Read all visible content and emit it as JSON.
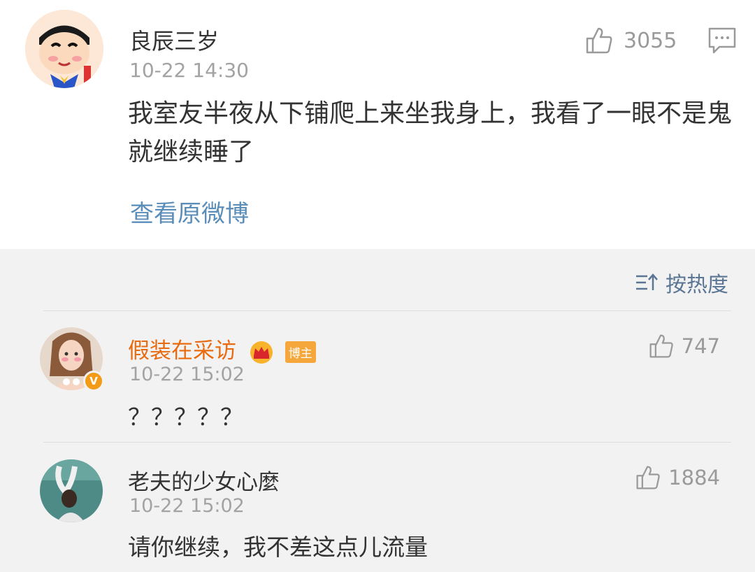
{
  "post": {
    "author": "良辰三岁",
    "time": "10-22 14:30",
    "like_count": "3055",
    "text": "我室友半夜从下铺爬上来坐我身上，我看了一眼不是鬼就继续睡了",
    "view_original": "查看原微博"
  },
  "sort": {
    "label": "按热度",
    "icon": "sort-icon"
  },
  "comments": [
    {
      "author": "假装在采访",
      "badge": "博主",
      "verified": "V",
      "time": "10-22 15:02",
      "like_count": "747",
      "text": "？？？？？"
    },
    {
      "author": "老夫的少女心麼",
      "time": "10-22 15:02",
      "like_count": "1884",
      "text": "请你继续，我不差这点儿流量"
    }
  ],
  "colors": {
    "link": "#5a8db8",
    "vip_name": "#e86b10",
    "owner_badge": "#f6a73b",
    "comments_bg": "#f2f2f2"
  }
}
